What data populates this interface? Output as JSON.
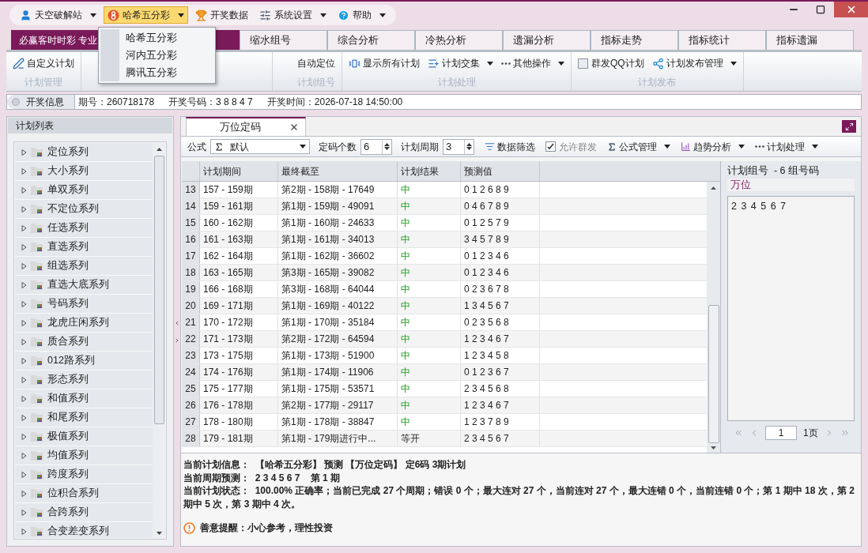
{
  "menu_bar": {
    "items": [
      {
        "label": "天空破解站",
        "dropdown": true,
        "selected": false
      },
      {
        "label": "哈希五分彩",
        "dropdown": true,
        "selected": true
      },
      {
        "label": "开奖数据",
        "dropdown": false,
        "selected": false
      },
      {
        "label": "系统设置",
        "dropdown": true,
        "selected": false
      },
      {
        "label": "帮助",
        "dropdown": true,
        "selected": false
      }
    ]
  },
  "dropdown_menu": {
    "items": [
      "哈希五分彩",
      "河内五分彩",
      "腾讯五分彩"
    ]
  },
  "tabs": [
    {
      "label": "必赢客时时彩 专业",
      "selected": true
    },
    {
      "label": "缩水组号",
      "selected": false
    },
    {
      "label": "综合分析",
      "selected": false
    },
    {
      "label": "冷热分析",
      "selected": false
    },
    {
      "label": "遗漏分析",
      "selected": false
    },
    {
      "label": "指标走势",
      "selected": false
    },
    {
      "label": "指标统计",
      "selected": false
    },
    {
      "label": "指标遗漏",
      "selected": false
    }
  ],
  "ribbon": {
    "groups": [
      {
        "label": "计划管理",
        "items": [
          {
            "label": "自定义计划",
            "kind": "button"
          }
        ]
      },
      {
        "label": "计划组号",
        "items": [
          {
            "label": "自动定位",
            "kind": "button"
          }
        ]
      },
      {
        "label": "计划处理",
        "items": [
          {
            "label": "显示所有计划",
            "kind": "button"
          },
          {
            "label": "计划交集",
            "kind": "dropdown"
          },
          {
            "label": "其他操作",
            "kind": "dropdown"
          }
        ]
      },
      {
        "label": "计划发布",
        "items": [
          {
            "label": "群发QQ计划",
            "kind": "checkbox",
            "checked": false
          },
          {
            "label": "计划发布管理",
            "kind": "dropdown"
          }
        ]
      }
    ]
  },
  "draw_info": {
    "toggle_label": "开奖信息",
    "issue": "期号：260718178",
    "numbers": "开奖号码：3 8 8 4 7",
    "time": "开奖时间：2026-07-18 14:50:00"
  },
  "plan_list": {
    "title": "计划列表",
    "items": [
      {
        "label": "定位系列",
        "expanded": false
      },
      {
        "label": "大小系列",
        "expanded": false
      },
      {
        "label": "单双系列",
        "expanded": false
      },
      {
        "label": "不定位系列",
        "expanded": false
      },
      {
        "label": "任选系列",
        "expanded": false
      },
      {
        "label": "直选系列",
        "expanded": false
      },
      {
        "label": "组选系列",
        "expanded": false
      },
      {
        "label": "直选大底系列",
        "expanded": false
      },
      {
        "label": "号码系列",
        "expanded": false
      },
      {
        "label": "龙虎庄闲系列",
        "expanded": false
      },
      {
        "label": "质合系列",
        "expanded": false
      },
      {
        "label": "012路系列",
        "expanded": false
      },
      {
        "label": "形态系列",
        "expanded": false
      },
      {
        "label": "和值系列",
        "expanded": false
      },
      {
        "label": "和尾系列",
        "expanded": false
      },
      {
        "label": "极值系列",
        "expanded": false
      },
      {
        "label": "均值系列",
        "expanded": false
      },
      {
        "label": "跨度系列",
        "expanded": false
      },
      {
        "label": "位积合系列",
        "expanded": false
      },
      {
        "label": "合跨系列",
        "expanded": false
      },
      {
        "label": "合变差变系列",
        "expanded": false
      }
    ]
  },
  "document_tab": {
    "label": "万位定码",
    "selected": true
  },
  "toolbar": {
    "formula_label": "公式",
    "formula_value": "默认",
    "count_label": "定码个数",
    "count_value": "6",
    "cycle_label": "计划周期",
    "cycle_value": "3",
    "filter": "数据筛选",
    "allow_broadcast": {
      "label": "允许群发",
      "checked": true,
      "disabled": true
    },
    "menus": [
      "公式管理",
      "趋势分析",
      "计划处理"
    ]
  },
  "table": {
    "columns": [
      "计划期间",
      "最终截至",
      "计划结果",
      "预测值"
    ],
    "rows": [
      {
        "index": "13",
        "period": "157 - 159期",
        "until": "第2期 - 158期 - 17649",
        "result": "中",
        "kind": "hit",
        "prediction": "0 1 2 6 8 9"
      },
      {
        "index": "14",
        "period": "159 - 161期",
        "until": "第1期 - 159期 - 49091",
        "result": "中",
        "kind": "hit",
        "prediction": "0 4 6 7 8 9"
      },
      {
        "index": "15",
        "period": "160 - 162期",
        "until": "第1期 - 160期 - 24633",
        "result": "中",
        "kind": "hit",
        "prediction": "0 1 2 5 7 9"
      },
      {
        "index": "16",
        "period": "161 - 163期",
        "until": "第1期 - 161期 - 34013",
        "result": "中",
        "kind": "hit",
        "prediction": "3 4 5 7 8 9"
      },
      {
        "index": "17",
        "period": "162 - 164期",
        "until": "第1期 - 162期 - 36602",
        "result": "中",
        "kind": "hit",
        "prediction": "0 1 2 3 4 6"
      },
      {
        "index": "18",
        "period": "163 - 165期",
        "until": "第3期 - 165期 - 39082",
        "result": "中",
        "kind": "hit",
        "prediction": "0 1 2 3 4 6"
      },
      {
        "index": "19",
        "period": "166 - 168期",
        "until": "第3期 - 168期 - 64044",
        "result": "中",
        "kind": "hit",
        "prediction": "0 2 3 6 7 8"
      },
      {
        "index": "20",
        "period": "169 - 171期",
        "until": "第1期 - 169期 - 40122",
        "result": "中",
        "kind": "hit",
        "prediction": "1 3 4 5 6 7"
      },
      {
        "index": "21",
        "period": "170 - 172期",
        "until": "第1期 - 170期 - 35184",
        "result": "中",
        "kind": "hit",
        "prediction": "0 2 3 5 6 8"
      },
      {
        "index": "22",
        "period": "171 - 173期",
        "until": "第2期 - 172期 - 64594",
        "result": "中",
        "kind": "hit",
        "prediction": "1 2 3 4 6 7"
      },
      {
        "index": "23",
        "period": "173 - 175期",
        "until": "第1期 - 173期 - 51900",
        "result": "中",
        "kind": "hit",
        "prediction": "1 2 3 4 5 8"
      },
      {
        "index": "24",
        "period": "174 - 176期",
        "until": "第1期 - 174期 - 11906",
        "result": "中",
        "kind": "hit",
        "prediction": "0 1 2 3 6 7"
      },
      {
        "index": "25",
        "period": "175 - 177期",
        "until": "第1期 - 175期 - 53571",
        "result": "中",
        "kind": "hit",
        "prediction": "2 3 4 5 6 8"
      },
      {
        "index": "26",
        "period": "176 - 178期",
        "until": "第2期 - 177期 - 29117",
        "result": "中",
        "kind": "hit",
        "prediction": "1 2 3 4 6 7"
      },
      {
        "index": "27",
        "period": "178 - 180期",
        "until": "第1期 - 178期 - 38847",
        "result": "中",
        "kind": "hit",
        "prediction": "1 2 3 7 8 9"
      },
      {
        "index": "28",
        "period": "179 - 181期",
        "until": "第1期 - 179期进行中...",
        "result": "等开",
        "kind": "pending",
        "prediction": "2 3 4 5 6 7"
      }
    ]
  },
  "group_panel": {
    "title": "计划组号  - 6 组号码",
    "position": "万位",
    "numbers": "2 3 4 5 6 7",
    "page_value": "1",
    "page_total": "1页"
  },
  "summary": {
    "lines": [
      "当前计划信息：  【哈希五分彩】 预测 【万位定码】 定6码 3期计划",
      "当前周期预测：  2 3 4 5 6 7    第 1 期",
      "当前计划状态：  100.00% 正确率；当前已完成 27 个周期；错误 0 个；最大连对 27 个，当前连对 27 个，最大连错 0 个，当前连错 0 个；第 1 期中 18 次，第 2 期中 5 次，第 3 期中 4 次。"
    ],
    "reminder": "善意提醒：小心参考，理性投资"
  }
}
